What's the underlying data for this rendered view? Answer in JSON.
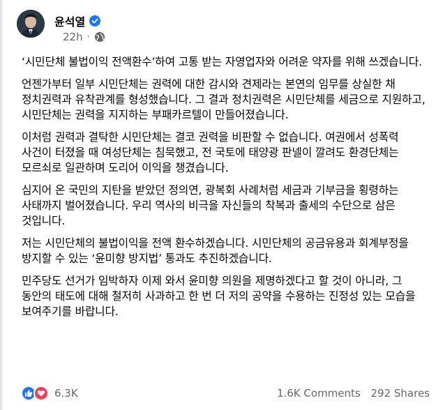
{
  "post": {
    "author": "윤석열",
    "timestamp": "22h",
    "paragraphs": [
      "‘시민단체 불법이익 전액환수’하여 고통 받는 자영업자와 어려운 약자를 위해 쓰겠습니다.",
      "언젠가부터 일부 시민단체는 권력에 대한 감시와 견제라는 본연의 임무를 상실한 채 정치권력과 유착관계를 형성했습니다. 그 결과 정치권력은 시민단체를 세금으로 지원하고, 시민단체는 권력을 지지하는 부패카르텔이 만들어졌습니다.",
      "이처럼 권력과 결탁한 시민단체는 결코 권력을 비판할 수 없습니다. 여권에서 성폭력 사건이 터졌을 때 여성단체는 침묵했고, 전 국토에 태양광 판넬이 깔려도 환경단체는 모르쇠로 일관하며 도리어 이익을 챙겼습니다.",
      "심지어 온 국민의 지탄을 받았던 정의연, 광복회 사례처럼 세금과 기부금을 횡령하는 사태까지 벌어졌습니다. 우리 역사의 비극을 자신들의 착복과 출세의 수단으로 삼은 것입니다.",
      "저는 시민단체의 불법이익을 전액 환수하겠습니다. 시민단체의 공금유용과 회계부정을 방지할 수 있는 ‘윤미향 방지법’ 통과도 추진하겠습니다.",
      "민주당도 선거가 임박하자 이제 와서 윤미향 의원을 제명하겠다고 할 것이 아니라, 그 동안의 태도에 대해 철저히 사과하고 한 번 더 저의 공약을 수용하는 진정성 있는 모습을 보여주기를 바랍니다."
    ]
  },
  "icons": {
    "verified": "verified-badge-icon",
    "audience": "globe-icon",
    "like": "like-icon",
    "love": "love-icon"
  },
  "colors": {
    "accent": "#1877f2",
    "love": "#f33e58",
    "secondary_text": "#65676b"
  },
  "footer": {
    "reaction_count": "6.3K",
    "comments": "1.6K Comments",
    "shares": "292 Shares"
  }
}
